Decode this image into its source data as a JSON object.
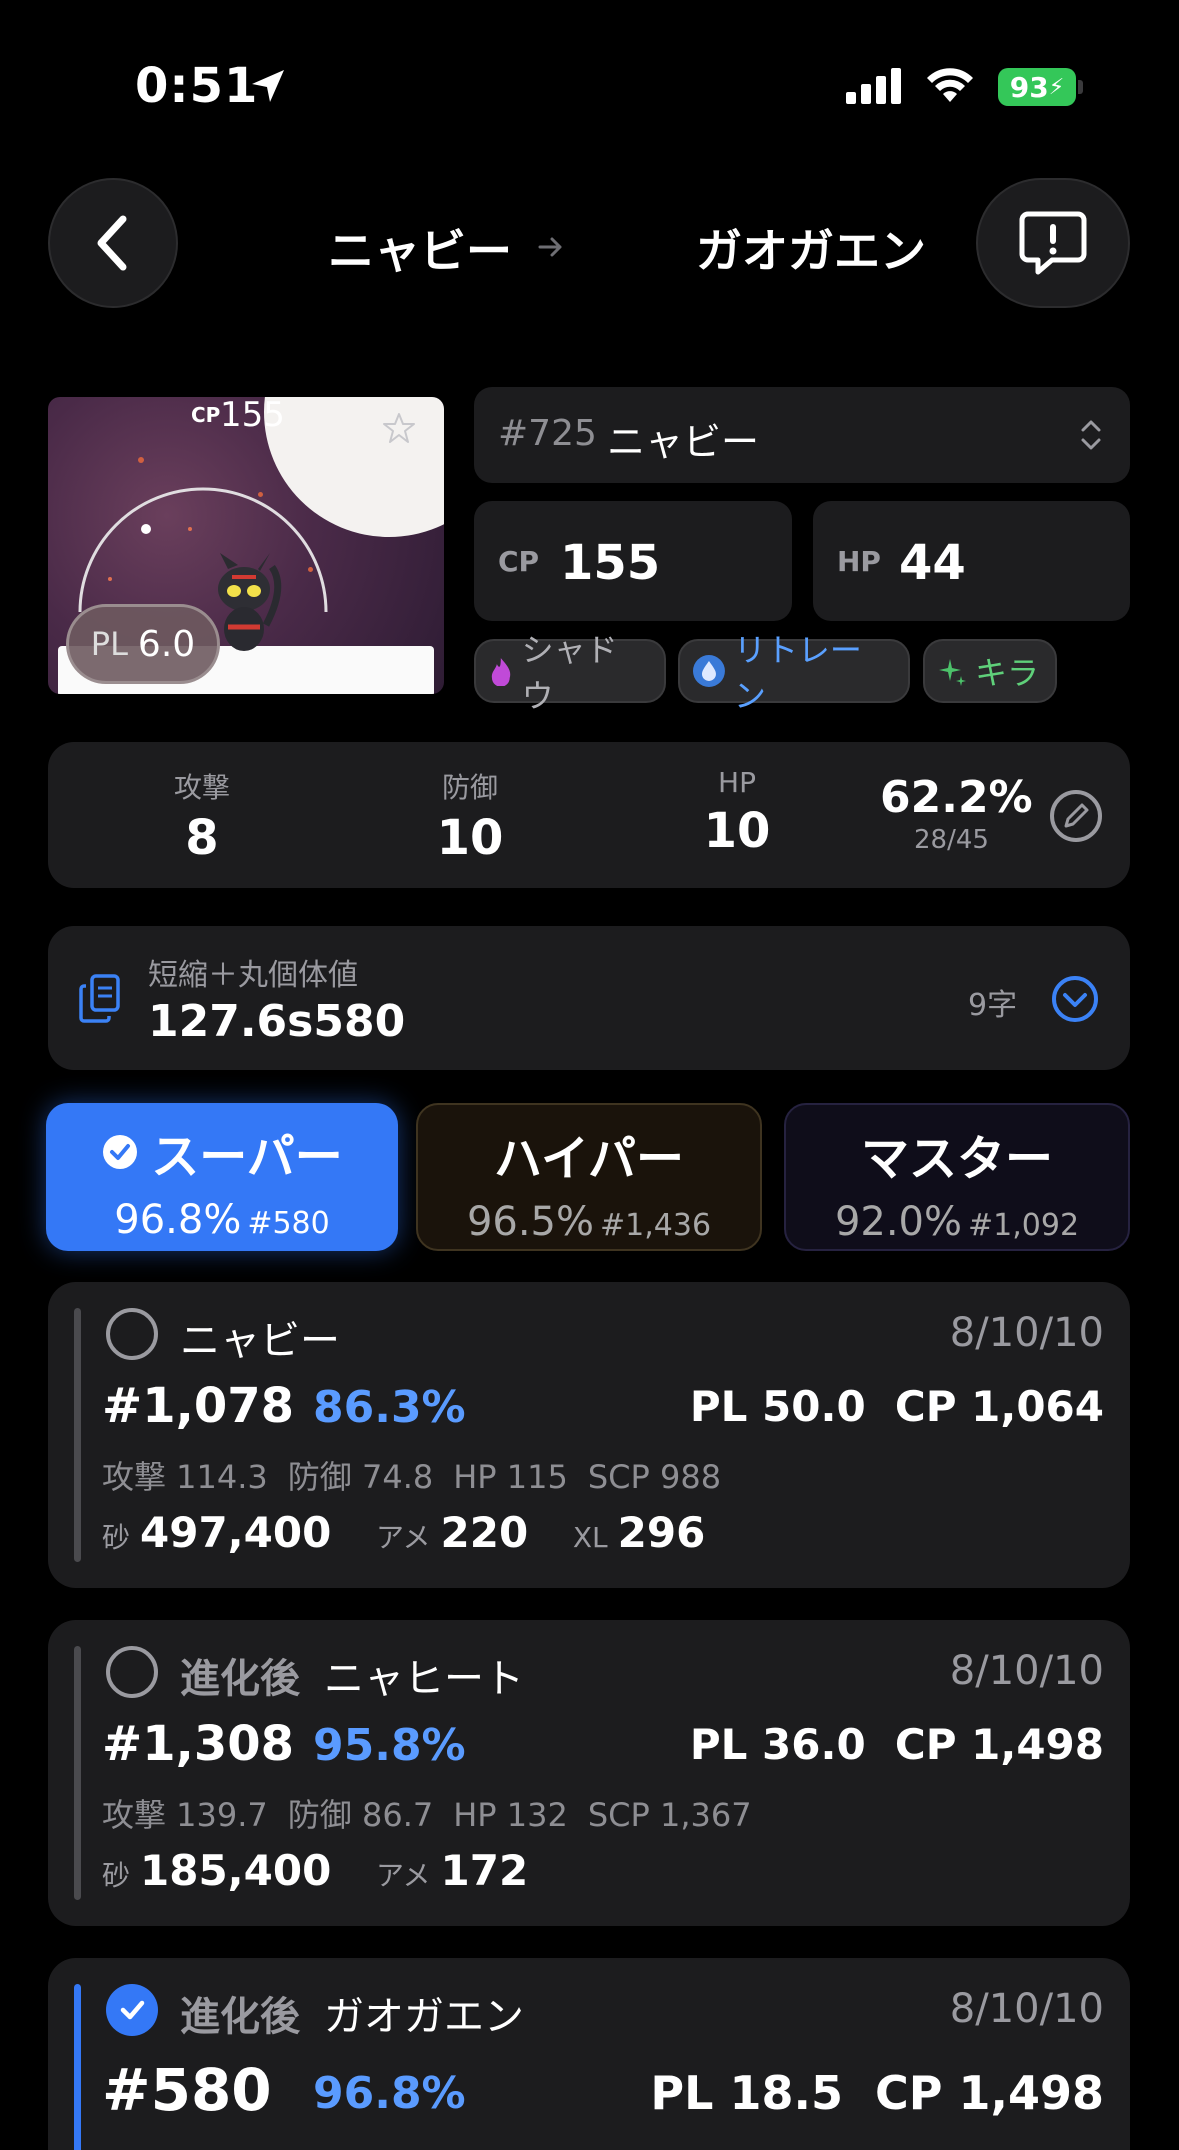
{
  "status_bar": {
    "time": "0:51",
    "battery": "93"
  },
  "header": {
    "from": "ニャビー",
    "to": "ガオガエン"
  },
  "pokemon": {
    "image_cp_label": "CP",
    "image_cp": "155",
    "pl_label": "PL",
    "pl": "6.0",
    "dex": "#725",
    "name": "ニャビー",
    "cp_label": "CP",
    "cp": "155",
    "hp_label": "HP",
    "hp": "44"
  },
  "chips": {
    "shadow": "シャドウ",
    "purified": "リトレーン",
    "shiny": "キラ"
  },
  "ivs": {
    "attack_label": "攻撃",
    "attack": "8",
    "defense_label": "防御",
    "defense": "10",
    "hp_label": "HP",
    "hp": "10",
    "percent": "62.2%",
    "sum": "28/45"
  },
  "short_code": {
    "label": "短縮＋丸個体値",
    "value": "127.6s580",
    "count": "9字"
  },
  "leagues": [
    {
      "name": "スーパー",
      "pct": "96.8%",
      "rank": "#580"
    },
    {
      "name": "ハイパー",
      "pct": "96.5%",
      "rank": "#1,436"
    },
    {
      "name": "マスター",
      "pct": "92.0%",
      "rank": "#1,092"
    }
  ],
  "rankings": [
    {
      "prefix": "",
      "name": "ニャビー",
      "ivs": "8/10/10",
      "rank": "#1,078",
      "pct": "86.3%",
      "pl": "PL 50.0",
      "cp": "CP 1,064",
      "atk": "攻撃 114.3",
      "def": "防御 74.8",
      "hp": "HP 115",
      "scp": "SCP 988",
      "stardust_label": "砂",
      "stardust": "497,400",
      "candy_label": "アメ",
      "candy": "220",
      "xl_label": "XL",
      "xl": "296"
    },
    {
      "prefix": "進化後",
      "name": "ニャヒート",
      "ivs": "8/10/10",
      "rank": "#1,308",
      "pct": "95.8%",
      "pl": "PL 36.0",
      "cp": "CP 1,498",
      "atk": "攻撃 139.7",
      "def": "防御 86.7",
      "hp": "HP 132",
      "scp": "SCP 1,367",
      "stardust_label": "砂",
      "stardust": "185,400",
      "candy_label": "アメ",
      "candy": "172"
    },
    {
      "prefix": "進化後",
      "name": "ガオガエン",
      "ivs": "8/10/10",
      "rank": "#580",
      "pct": "96.8%",
      "pl": "PL 18.5",
      "cp": "CP 1,498"
    }
  ],
  "colors": {
    "accent": "#3478f6",
    "card": "#1c1c1e",
    "background": "#000000",
    "battery": "#34c759"
  }
}
